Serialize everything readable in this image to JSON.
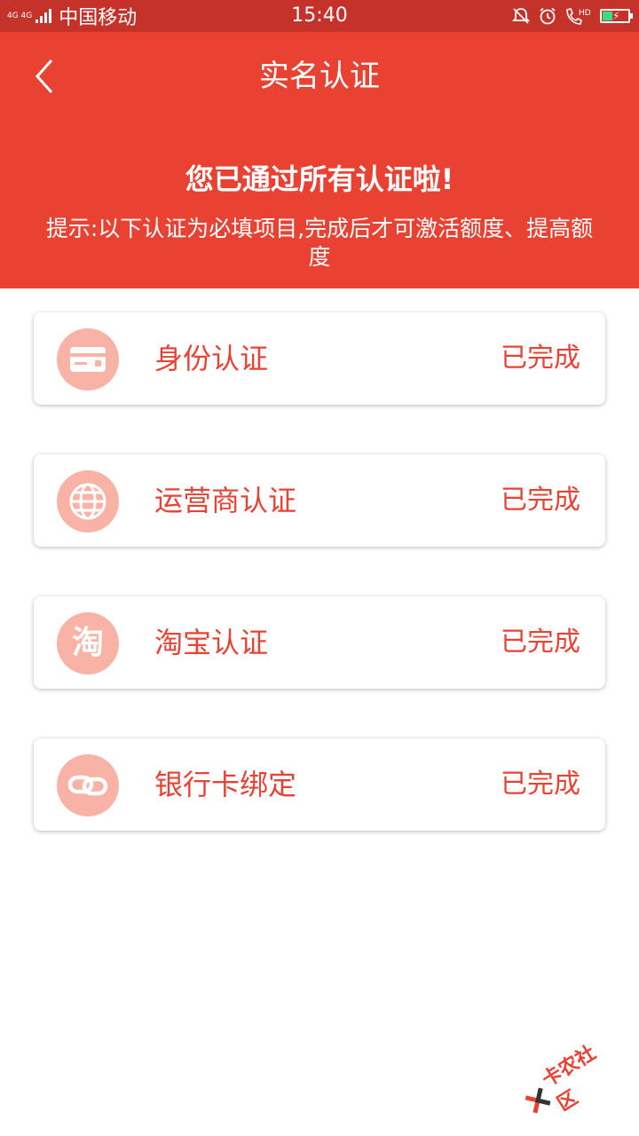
{
  "status_bar": {
    "network": "4G 4G",
    "carrier": "中国移动",
    "time": "15:40",
    "hd": "HD"
  },
  "header": {
    "title": "实名认证",
    "success_message": "您已通过所有认证啦!",
    "tip": "提示:以下认证为必填项目,完成后才可激活额度、提高额度"
  },
  "items": [
    {
      "label": "身份认证",
      "status": "已完成",
      "icon": "id-card-icon"
    },
    {
      "label": "运营商认证",
      "status": "已完成",
      "icon": "globe-icon"
    },
    {
      "label": "淘宝认证",
      "status": "已完成",
      "icon": "taobao-icon",
      "icon_text": "淘"
    },
    {
      "label": "银行卡绑定",
      "status": "已完成",
      "icon": "link-icon"
    }
  ],
  "watermark": {
    "text": "卡农社区"
  },
  "colors": {
    "primary": "#e94233",
    "status_bar": "#c53229",
    "icon_circle": "#f8b3a6",
    "background": "#ffffff"
  }
}
